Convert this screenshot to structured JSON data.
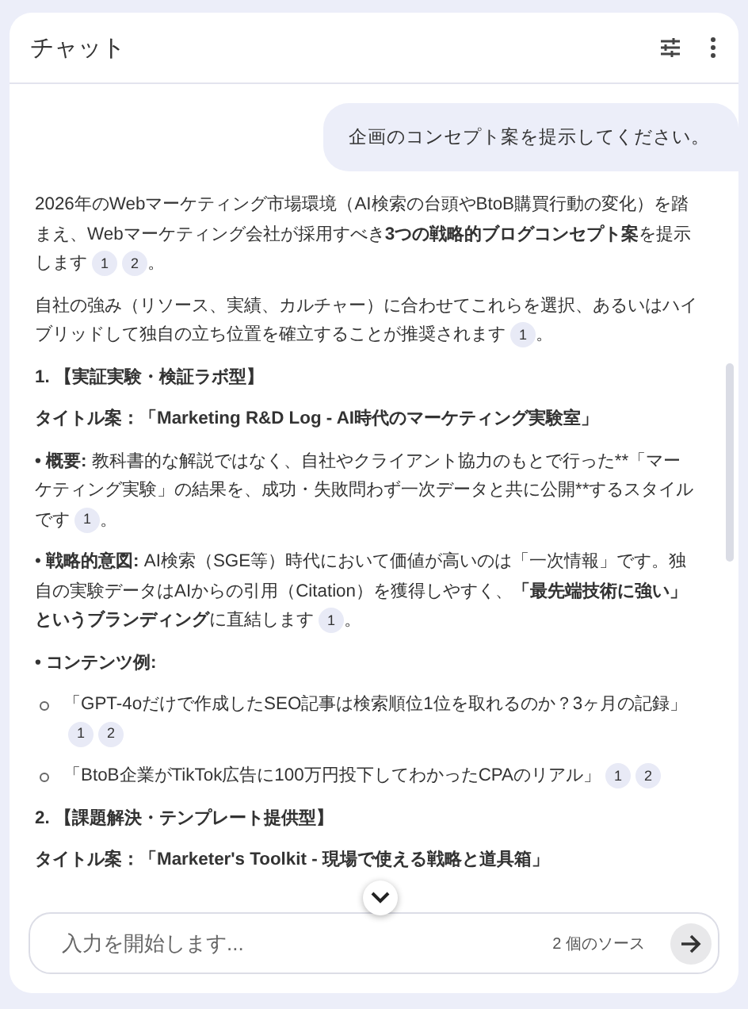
{
  "header": {
    "title": "チャット"
  },
  "user_message": "企画のコンセプト案を提示してください。",
  "blocks": [
    {
      "kind": "paragraph",
      "text": "2026年のWebマーケティング市場環境（AI検索の台頭やBtoB購買行動の変化）を踏まえ、Webマーケティング会社が採用すべき**3つの戦略的ブログコンセプト案**を提示します",
      "citations": [
        "1",
        "2"
      ],
      "tail": "。"
    },
    {
      "kind": "paragraph",
      "text": "自社の強み（リソース、実績、カルチャー）に合わせてこれらを選択、あるいはハイブリッドして独自の立ち位置を確立することが推奨されます",
      "citations": [
        "1"
      ],
      "tail": "。"
    },
    {
      "kind": "heading",
      "text": "1. 【実証実験・検証ラボ型】"
    },
    {
      "kind": "heading",
      "text": "タイトル案：「Marketing R&D Log - AI時代のマーケティング実験室」"
    },
    {
      "kind": "literal",
      "label": "• 概要:",
      "text": "教科書的な解説ではなく、自社やクライアント協力のもとで行った**「マーケティング実験」の結果を、成功・失敗問わず一次データと共に公開**するスタイルです",
      "citations": [
        "1"
      ],
      "tail": "。"
    },
    {
      "kind": "paragraph",
      "text": "• **戦略的意図:** AI検索（SGE等）時代において価値が高いのは「一次情報」です。独自の実験データはAIからの引用（Citation）を獲得しやすく、**「最先端技術に強い」というブランディング**に直結します",
      "citations": [
        "1"
      ],
      "tail": "。"
    },
    {
      "kind": "heading",
      "text": "• コンテンツ例:"
    },
    {
      "kind": "subitem",
      "text": "「GPT-4oだけで作成したSEO記事は検索順位1位を取れるのか？3ヶ月の記録」",
      "citations": [
        "1",
        "2"
      ]
    },
    {
      "kind": "subitem",
      "text": "「BtoB企業がTikTok広告に100万円投下してわかったCPAのリアル」",
      "citations": [
        "1",
        "2"
      ]
    },
    {
      "kind": "heading",
      "text": "2. 【課題解決・テンプレート提供型】"
    },
    {
      "kind": "heading",
      "text": "タイトル案：「Marketer's Toolkit - 現場で使える戦略と道具箱」"
    }
  ],
  "composer": {
    "placeholder": "入力を開始します...",
    "sources": "2 個のソース"
  }
}
